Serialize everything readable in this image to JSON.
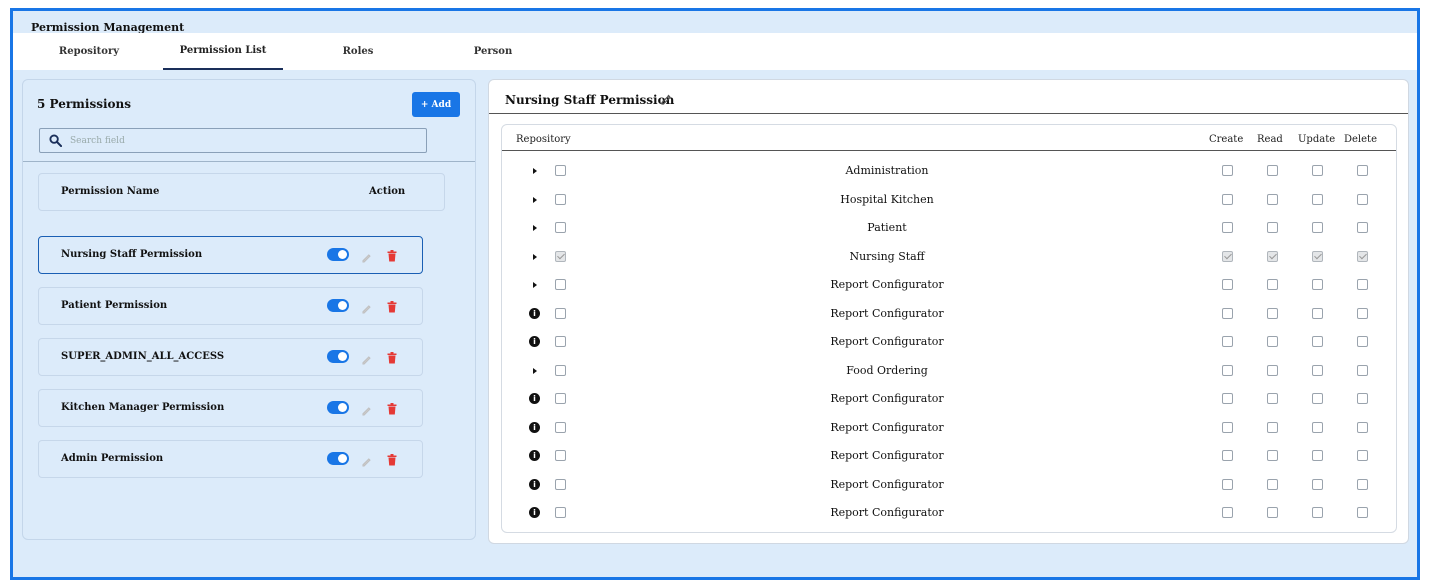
{
  "app": {
    "title": "Permission Management"
  },
  "tabs": [
    {
      "label": "Repository",
      "active": false
    },
    {
      "label": "Permission List",
      "active": true
    },
    {
      "label": "Roles",
      "active": false
    },
    {
      "label": "Person",
      "active": false
    }
  ],
  "left": {
    "count_label": "5 Permissions",
    "add_label": "+ Add",
    "search": {
      "placeholder": "Search field",
      "value": ""
    },
    "header": {
      "name": "Permission Name",
      "action": "Action"
    },
    "permissions": [
      {
        "name": "Nursing Staff Permission",
        "enabled": true,
        "selected": true
      },
      {
        "name": "Patient Permission",
        "enabled": true,
        "selected": false
      },
      {
        "name": "SUPER_ADMIN_ALL_ACCESS",
        "enabled": true,
        "selected": false
      },
      {
        "name": "Kitchen Manager Permission",
        "enabled": true,
        "selected": false
      },
      {
        "name": "Admin Permission",
        "enabled": true,
        "selected": false
      }
    ]
  },
  "right": {
    "title": "Nursing Staff Permission",
    "headers": {
      "repository": "Repository",
      "create": "Create",
      "read": "Read",
      "update": "Update",
      "delete": "Delete"
    },
    "rows": [
      {
        "name": "Administration",
        "kind": "caret",
        "checked": false
      },
      {
        "name": "Hospital Kitchen",
        "kind": "caret",
        "checked": false
      },
      {
        "name": "Patient",
        "kind": "caret",
        "checked": false
      },
      {
        "name": "Nursing Staff",
        "kind": "caret",
        "checked": true
      },
      {
        "name": "Report Configurator",
        "kind": "caret",
        "checked": false
      },
      {
        "name": "Report Configurator",
        "kind": "info",
        "checked": false
      },
      {
        "name": "Report Configurator",
        "kind": "info",
        "checked": false
      },
      {
        "name": "Food Ordering",
        "kind": "caret",
        "checked": false
      },
      {
        "name": "Report Configurator",
        "kind": "info",
        "checked": false
      },
      {
        "name": "Report Configurator",
        "kind": "info",
        "checked": false
      },
      {
        "name": "Report Configurator",
        "kind": "info",
        "checked": false
      },
      {
        "name": "Report Configurator",
        "kind": "info",
        "checked": false
      },
      {
        "name": "Report Configurator",
        "kind": "info",
        "checked": false
      }
    ]
  },
  "colors": {
    "accent": "#1976e6",
    "delete": "#e53935",
    "panel": "#dcebfa"
  },
  "icons": {
    "search": "search-icon",
    "edit": "pencil-icon",
    "delete": "trash-icon",
    "info": "info-icon"
  }
}
